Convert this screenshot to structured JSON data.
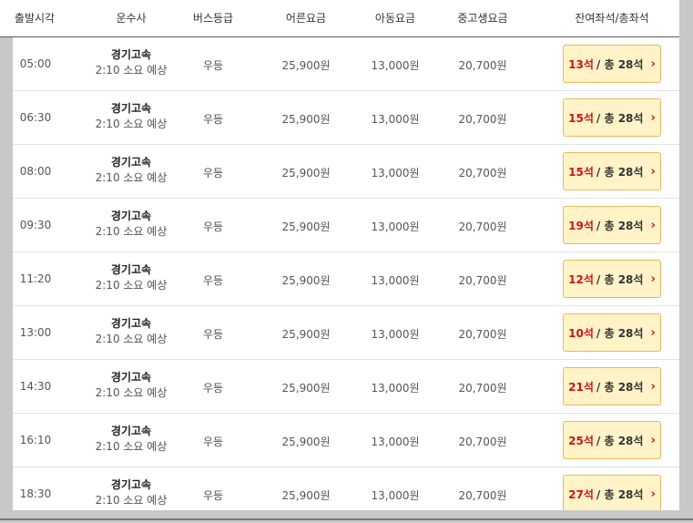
{
  "header": {
    "time": "출발시각",
    "company": "운수사",
    "grade": "버스등급",
    "adult": "어른요금",
    "child": "아동요금",
    "student": "중고생요금",
    "seats": "잔여좌석/총좌석"
  },
  "rows": [
    {
      "time": "05:00",
      "company": "경기고속",
      "duration": "2:10 소요 예상",
      "grade": "우등",
      "adult": "25,900원",
      "child": "13,000원",
      "student": "20,700원",
      "remain": "13석",
      "total": "/ 총 28석"
    },
    {
      "time": "06:30",
      "company": "경기고속",
      "duration": "2:10 소요 예상",
      "grade": "우등",
      "adult": "25,900원",
      "child": "13,000원",
      "student": "20,700원",
      "remain": "15석",
      "total": "/ 총 28석"
    },
    {
      "time": "08:00",
      "company": "경기고속",
      "duration": "2:10 소요 예상",
      "grade": "우등",
      "adult": "25,900원",
      "child": "13,000원",
      "student": "20,700원",
      "remain": "15석",
      "total": "/ 총 28석"
    },
    {
      "time": "09:30",
      "company": "경기고속",
      "duration": "2:10 소요 예상",
      "grade": "우등",
      "adult": "25,900원",
      "child": "13,000원",
      "student": "20,700원",
      "remain": "19석",
      "total": "/ 총 28석"
    },
    {
      "time": "11:20",
      "company": "경기고속",
      "duration": "2:10 소요 예상",
      "grade": "우등",
      "adult": "25,900원",
      "child": "13,000원",
      "student": "20,700원",
      "remain": "12석",
      "total": "/ 총 28석"
    },
    {
      "time": "13:00",
      "company": "경기고속",
      "duration": "2:10 소요 예상",
      "grade": "우등",
      "adult": "25,900원",
      "child": "13,000원",
      "student": "20,700원",
      "remain": "10석",
      "total": "/ 총 28석"
    },
    {
      "time": "14:30",
      "company": "경기고속",
      "duration": "2:10 소요 예상",
      "grade": "우등",
      "adult": "25,900원",
      "child": "13,000원",
      "student": "20,700원",
      "remain": "21석",
      "total": "/ 총 28석"
    },
    {
      "time": "16:10",
      "company": "경기고속",
      "duration": "2:10 소요 예상",
      "grade": "우등",
      "adult": "25,900원",
      "child": "13,000원",
      "student": "20,700원",
      "remain": "25석",
      "total": "/ 총 28석"
    },
    {
      "time": "18:30",
      "company": "경기고속",
      "duration": "2:10 소요 예상",
      "grade": "우등",
      "adult": "25,900원",
      "child": "13,000원",
      "student": "20,700원",
      "remain": "27석",
      "total": "/ 총 28석"
    }
  ],
  "icons": {
    "seat_arrow": "chevron-right-icon"
  },
  "colors": {
    "accent_red": "#d0111b",
    "button_bg": "#fff3c7",
    "button_border": "#e8b860"
  }
}
